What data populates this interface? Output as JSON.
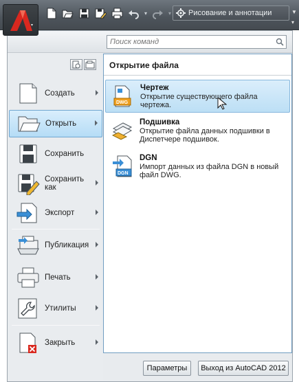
{
  "qat": {
    "workspace": "Рисование и аннотации",
    "icons": [
      "new-icon",
      "open-icon",
      "save-icon",
      "save-as-icon",
      "print-icon",
      "undo-icon",
      "redo-icon",
      "gear-icon"
    ]
  },
  "search": {
    "placeholder": "Поиск команд"
  },
  "menu": {
    "commands": [
      {
        "id": "create",
        "label": "Создать",
        "submenu": true
      },
      {
        "id": "open",
        "label": "Открыть",
        "submenu": true,
        "active": true
      },
      {
        "id": "save",
        "label": "Сохранить",
        "submenu": false
      },
      {
        "id": "save-as",
        "label": "Сохранить как",
        "submenu": true
      },
      {
        "id": "export",
        "label": "Экспорт",
        "submenu": true
      },
      {
        "id": "publish",
        "label": "Публикация",
        "submenu": true
      },
      {
        "id": "print",
        "label": "Печать",
        "submenu": true
      },
      {
        "id": "utilities",
        "label": "Утилиты",
        "submenu": true
      },
      {
        "id": "close",
        "label": "Закрыть",
        "submenu": true
      }
    ]
  },
  "panel": {
    "title": "Открытие файла",
    "items": [
      {
        "title": "Чертеж",
        "desc": "Открытие существующего файла чертежа.",
        "icon": "dwg-file-icon",
        "badge": "DWG"
      },
      {
        "title": "Подшивка",
        "desc": "Открытие файла данных подшивки в Диспетчере подшивок.",
        "icon": "sheet-set-icon"
      },
      {
        "title": "DGN",
        "desc": "Импорт данных из файла DGN в новый файл DWG.",
        "icon": "dgn-file-icon",
        "badge": "DGN"
      }
    ]
  },
  "bottom": {
    "options": "Параметры",
    "exit": "Выход из AutoCAD 2012"
  },
  "colors": {
    "accent": "#3b8ed6",
    "panel_border": "#6f9cc1",
    "highlight": "#bcdff5"
  }
}
